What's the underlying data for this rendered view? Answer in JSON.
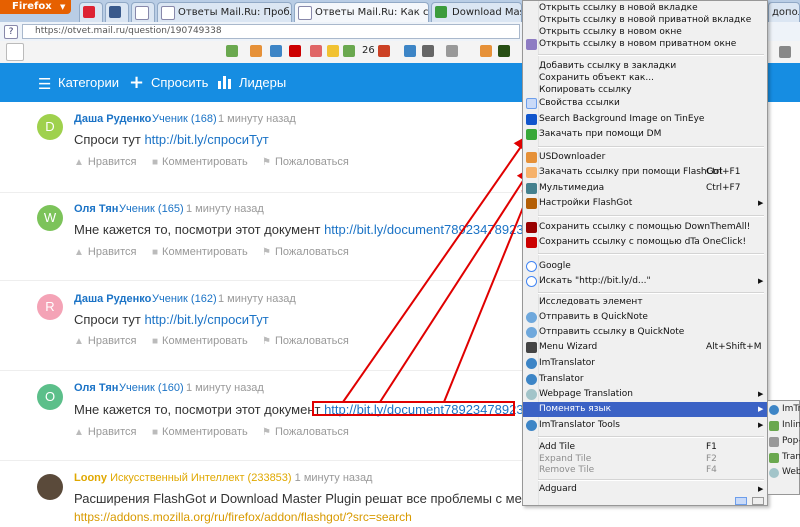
{
  "browser": {
    "app_button": "Firefox",
    "tabs": [
      {
        "label": "",
        "active": false
      },
      {
        "label": "",
        "active": false
      },
      {
        "label": "",
        "active": false
      },
      {
        "label": "Ответы Mail.Ru: Пробле...",
        "active": false
      },
      {
        "label": "Ответы Mail.Ru: Как сде...",
        "active": true
      },
      {
        "label": "Download Master I",
        "active": false
      }
    ],
    "right_tab_fragment": "дополн",
    "url": "https://otvet.mail.ru/question/190749338",
    "toolbar_count": "26"
  },
  "site": {
    "nav": [
      {
        "icon": "list-icon",
        "label": "Категории"
      },
      {
        "icon": "plus-icon",
        "label": "Спросить"
      },
      {
        "icon": "bar-chart-icon",
        "label": "Лидеры"
      }
    ]
  },
  "answers": [
    {
      "letter": "D",
      "avatar_color": "#9fd14d",
      "author": "Даша Руденко",
      "rank": "Ученик (168)",
      "time": "1 минуту назад",
      "text": "Спроси тут ",
      "link": "http://bit.ly/спросиТут",
      "actions": [
        "Нравится",
        "Комментировать",
        "Пожаловаться"
      ]
    },
    {
      "letter": "W",
      "avatar_color": "#7cc35a",
      "author": "Оля Тян",
      "rank": "Ученик (165)",
      "time": "1 минуту назад",
      "text": "Мне кажется то, посмотри этот документ ",
      "link": "http://bit.ly/document789234789234-р",
      "actions": [
        "Нравится",
        "Комментировать",
        "Пожаловаться"
      ]
    },
    {
      "letter": "R",
      "avatar_color": "#f4a3b6",
      "author": "Даша Руденко",
      "rank": "Ученик (162)",
      "time": "1 минуту назад",
      "text": "Спроси тут ",
      "link": "http://bit.ly/спросиТут",
      "actions": [
        "Нравится",
        "Комментировать",
        "Пожаловаться"
      ]
    },
    {
      "letter": "O",
      "avatar_color": "#5cbf8a",
      "author": "Оля Тян",
      "rank": "Ученик (160)",
      "time": "1 минуту назад",
      "text": "Мне кажется то, посмотри этот документ ",
      "link": "http://bit.ly/document789234789234-р",
      "actions": [
        "Нравится",
        "Комментировать",
        "Пожаловаться"
      ]
    },
    {
      "letter": "",
      "avatar_color": "#5a4a3a",
      "author": "Loony",
      "rank": "Искусственный Интеллект (233853)",
      "time": "1 минуту назад",
      "text": "Расширения FlashGot и Download Master Plugin решат все проблемы с менедж",
      "link": "https://addons.mozilla.org/ru/firefox/addon/flashgot/?src=search",
      "actions": []
    }
  ],
  "context_menu": [
    {
      "label": "Открыть ссылку в новой вкладке",
      "icon": ""
    },
    {
      "label": "Открыть ссылку в новой приватной вкладке",
      "icon": ""
    },
    {
      "label": "Открыть ссылку в новом окне",
      "icon": ""
    },
    {
      "label": "Открыть ссылку в новом приватном окне",
      "icon": "private-window-icon"
    },
    {
      "sep": true
    },
    {
      "label": "Добавить ссылку в закладки",
      "icon": ""
    },
    {
      "label": "Сохранить объект как...",
      "icon": ""
    },
    {
      "label": "Копировать ссылку",
      "icon": ""
    },
    {
      "label": "Свойства ссылки",
      "icon": "properties-icon"
    },
    {
      "label": "Search Background Image on TinEye",
      "icon": "tineye-icon"
    },
    {
      "label": "Закачать при помощи DM",
      "icon": "download-master-icon"
    },
    {
      "sep": true
    },
    {
      "label": "USDownloader",
      "icon": "usdownloader-icon"
    },
    {
      "label": "Закачать ссылку при помощи FlashGot",
      "shortcut": "Ctrl+F1",
      "icon": "flashgot-icon"
    },
    {
      "label": "Мультимедиа",
      "shortcut": "Ctrl+F7",
      "icon": "multimedia-icon"
    },
    {
      "label": "Настройки FlashGot",
      "submenu": true,
      "icon": "flashgot-settings-icon"
    },
    {
      "sep": true
    },
    {
      "label": "Сохранить ссылку с помощью DownThemAll!",
      "icon": "downthemall-icon"
    },
    {
      "label": "Сохранить ссылку с помощью dTa OneClick!",
      "icon": "dta-oneclick-icon"
    },
    {
      "sep": true
    },
    {
      "label": "Google",
      "icon": "google-icon"
    },
    {
      "label": "Искать \"http://bit.ly/d...\"",
      "submenu": true,
      "icon": "search-icon"
    },
    {
      "sep": true
    },
    {
      "label": "Исследовать элемент",
      "icon": ""
    },
    {
      "label": "Отправить в QuickNote",
      "icon": "quicknote-icon"
    },
    {
      "label": "Отправить ссылку в QuickNote",
      "icon": "quicknote-icon"
    },
    {
      "label": "Menu Wizard",
      "shortcut": "Alt+Shift+M",
      "icon": "menu-wizard-icon"
    },
    {
      "label": "ImTranslator",
      "icon": "imtranslator-icon"
    },
    {
      "label": "Translator",
      "icon": "translator-icon"
    },
    {
      "label": "Webpage Translation",
      "submenu": true,
      "icon": "webpage-translation-icon"
    },
    {
      "label": "Поменять язык",
      "submenu": true,
      "highlighted": true,
      "icon": ""
    },
    {
      "label": "ImTranslator Tools",
      "submenu": true,
      "icon": "imtranslator-tools-icon"
    },
    {
      "sep": true
    },
    {
      "label": "Add Tile",
      "shortcut": "F1",
      "icon": ""
    },
    {
      "label": "Expand Tile",
      "shortcut": "F2",
      "disabled": true,
      "icon": ""
    },
    {
      "label": "Remove Tile",
      "shortcut": "F4",
      "disabled": true,
      "icon": ""
    },
    {
      "sep": true
    },
    {
      "label": "Adguard",
      "submenu": true,
      "icon": ""
    }
  ],
  "submenu": [
    {
      "label": "ImTr",
      "icon": "imtranslator-icon"
    },
    {
      "label": "Inline",
      "icon": "inline-icon"
    },
    {
      "label": "Pop-",
      "icon": "popup-icon"
    },
    {
      "label": "Tran",
      "icon": "translate-icon"
    },
    {
      "label": "Web",
      "icon": "web-icon"
    }
  ],
  "colors": {
    "site_header": "#168de2",
    "link": "#1b73c6",
    "annotation_red": "#e00000",
    "menu_highlight": "#3b62c5",
    "firefox_button": "#e66000"
  }
}
